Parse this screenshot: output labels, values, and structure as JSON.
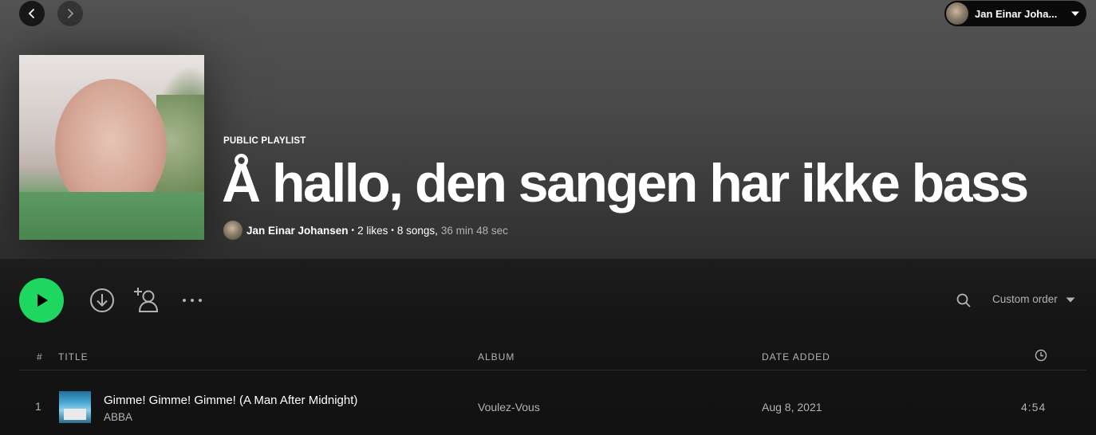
{
  "nav": {
    "back_icon": "chevron-left-icon",
    "forward_icon": "chevron-right-icon"
  },
  "user": {
    "name": "Jan Einar Johansen",
    "display_name": "Jan Einar Joha..."
  },
  "playlist": {
    "type_label": "PUBLIC PLAYLIST",
    "title": "Å hallo, den sangen har ikke bass",
    "owner": "Jan Einar Johansen",
    "likes": "2 likes",
    "songs": "8 songs,",
    "duration": "36 min 48 sec"
  },
  "actions": {
    "sort_label": "Custom order"
  },
  "table": {
    "headers": {
      "number": "#",
      "title": "TITLE",
      "album": "ALBUM",
      "date_added": "DATE ADDED"
    },
    "rows": [
      {
        "number": "1",
        "title": "Gimme! Gimme! Gimme! (A Man After Midnight)",
        "artist": "ABBA",
        "album": "Voulez-Vous",
        "date_added": "Aug 8, 2021",
        "duration": "4:54"
      }
    ]
  },
  "colors": {
    "accent": "#1ed760",
    "background": "#121212",
    "secondary_text": "#b3b3b3"
  }
}
